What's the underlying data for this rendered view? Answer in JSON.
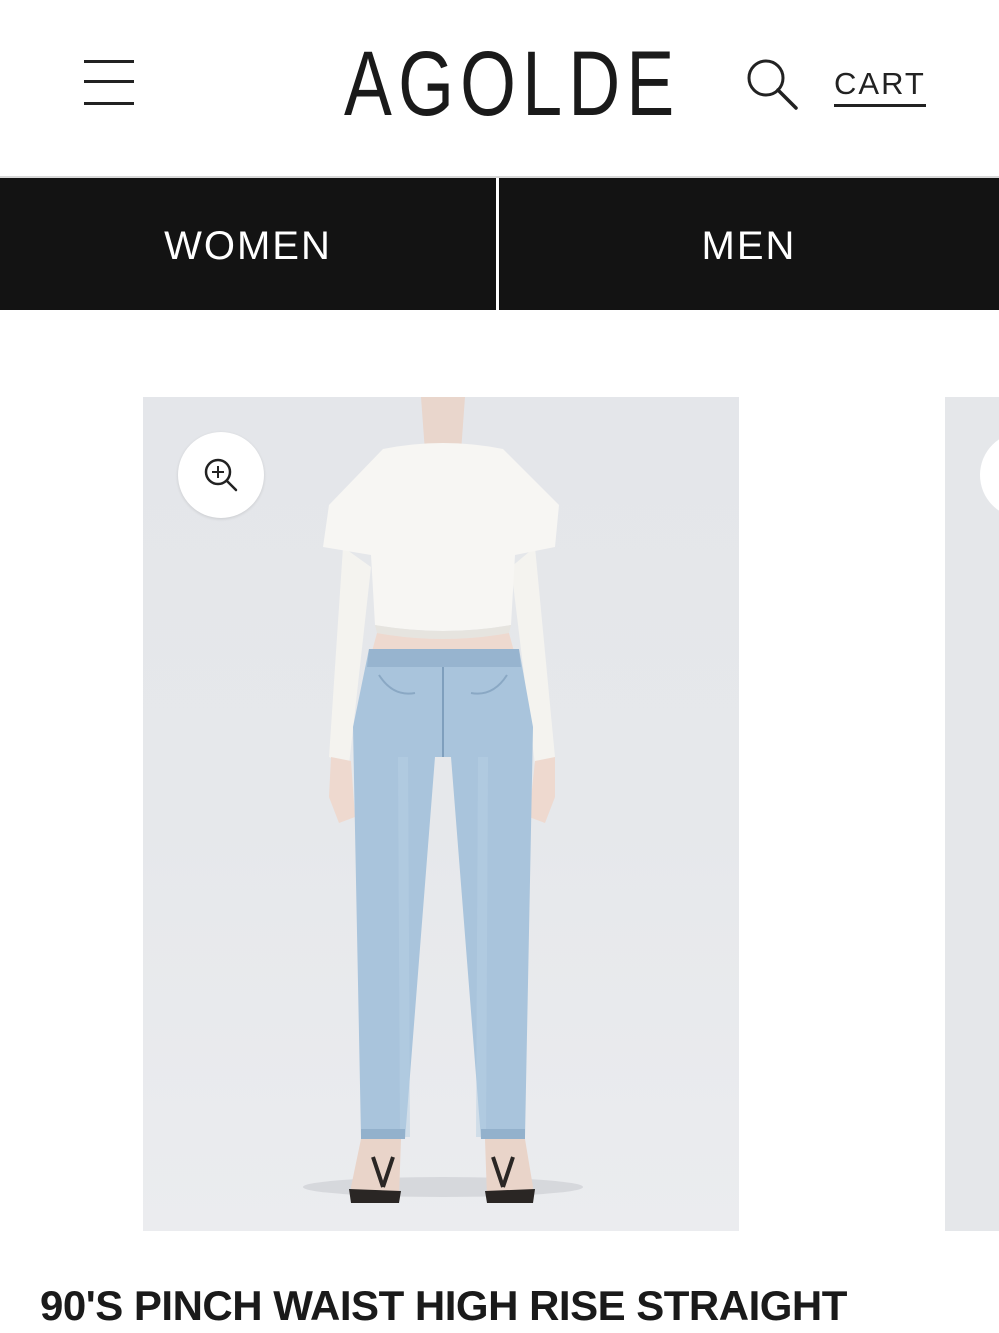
{
  "header": {
    "logo": "AGOLDE",
    "menu_icon": "hamburger-menu-icon",
    "search_icon": "search-icon",
    "cart_label": "CART"
  },
  "nav": {
    "items": [
      {
        "label": "WOMEN"
      },
      {
        "label": "MEN"
      }
    ]
  },
  "product": {
    "zoom_icon": "zoom-in-icon",
    "title": "90'S PINCH WAIST HIGH RISE STRAIGHT"
  },
  "colors": {
    "nav_background": "#131313",
    "text": "#111111",
    "image_background": "#e6e8eb"
  }
}
